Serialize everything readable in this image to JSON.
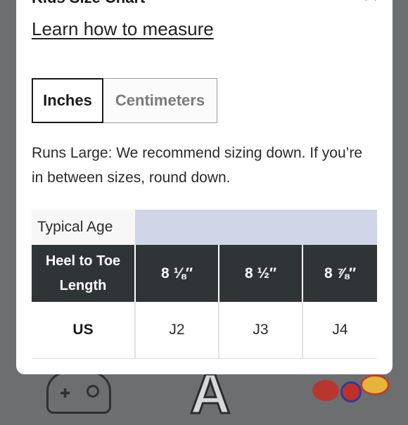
{
  "modal": {
    "title": "Kids Size Chart",
    "close_label": "✕",
    "learn_link": "Learn how to measure",
    "units": [
      {
        "label": "Inches",
        "selected": true
      },
      {
        "label": "Centimeters",
        "selected": false
      }
    ],
    "note": "Runs Large: We recommend sizing down. If you’re in between sizes, round down."
  },
  "size_table": {
    "age_label": "Typical Age",
    "heel_label": "Heel to Toe Length",
    "us_label": "US",
    "columns": [
      {
        "heel": "8 ⅛″",
        "us": "J2"
      },
      {
        "heel": "8 ½″",
        "us": "J3"
      },
      {
        "heel": "8 ⅞″",
        "us": "J4"
      }
    ]
  },
  "background": {
    "letter": "A"
  },
  "colors": {
    "table_header": "#2f3437",
    "age_row": "#d0d6e8",
    "backdrop": "#6d6e70"
  }
}
